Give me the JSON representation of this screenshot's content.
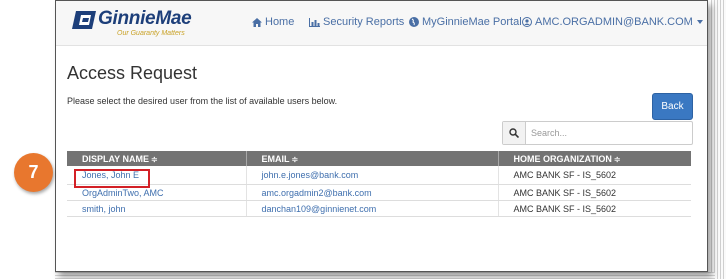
{
  "brand": {
    "name": "GinnieMae",
    "tagline": "Our Guaranty Matters"
  },
  "nav": {
    "home": "Home",
    "security_reports": "Security Reports",
    "portal": "MyGinnieMae Portal",
    "account": "AMC.ORGADMIN@BANK.COM"
  },
  "page": {
    "title": "Access Request",
    "instructions": "Please select the desired user from the list of available users below.",
    "back_label": "Back"
  },
  "search": {
    "placeholder": "Search..."
  },
  "table": {
    "columns": [
      "DISPLAY NAME",
      "EMAIL",
      "HOME ORGANIZATION"
    ],
    "rows": [
      [
        "Jones, John E",
        "john.e.jones@bank.com",
        "AMC BANK SF - IS_5602"
      ],
      [
        "OrgAdminTwo, AMC",
        "amc.orgadmin2@bank.com",
        "AMC BANK SF - IS_5602"
      ],
      [
        "smith, john",
        "danchan109@ginnienet.com",
        "AMC BANK SF - IS_5602"
      ]
    ],
    "sort_glyph": "≑"
  },
  "callout": {
    "step": "7"
  },
  "colors": {
    "brand_navy": "#1d3f7a",
    "link_blue": "#3f6fae",
    "button_blue": "#3a78c2",
    "header_gray": "#737373",
    "callout_orange": "#e8772e",
    "highlight_red": "#d32026"
  }
}
